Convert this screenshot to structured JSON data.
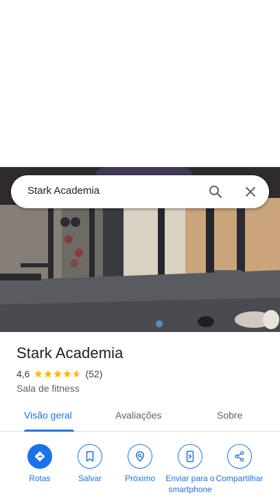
{
  "search": {
    "query": "Stark Academia"
  },
  "place": {
    "title": "Stark Academia",
    "rating": "4,6",
    "rating_stars": 4.6,
    "review_count": "(52)",
    "category": "Sala de fitness"
  },
  "tabs": [
    {
      "label": "Visão geral",
      "active": true
    },
    {
      "label": "Avaliações",
      "active": false
    },
    {
      "label": "Sobre",
      "active": false
    }
  ],
  "actions": [
    {
      "label": "Rotas",
      "icon": "directions-icon"
    },
    {
      "label": "Salvar",
      "icon": "bookmark-icon"
    },
    {
      "label": "Próximo",
      "icon": "nearby-icon"
    },
    {
      "label": "Enviar para o smartphone",
      "icon": "send-to-phone-icon"
    },
    {
      "label": "Compartilhar",
      "icon": "share-icon"
    }
  ],
  "colors": {
    "accent": "#1a73e8",
    "star": "#fbbc04",
    "text": "#202124",
    "secondary": "#5f6368"
  }
}
